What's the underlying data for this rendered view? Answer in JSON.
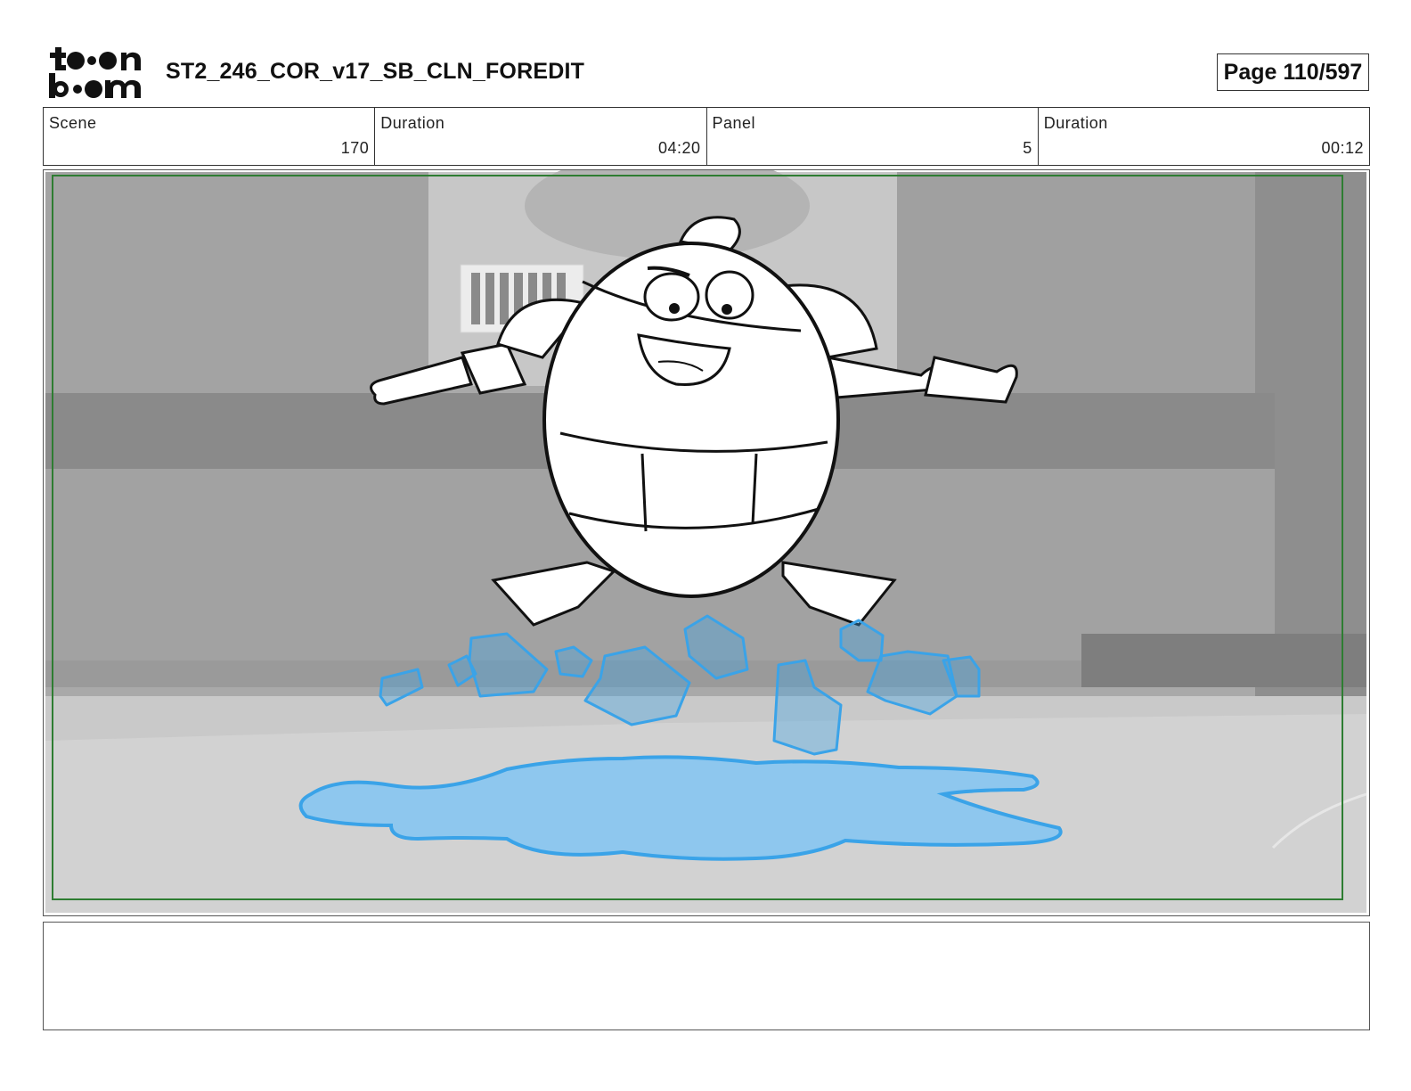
{
  "header": {
    "logo_alt": "toon boom",
    "title": "ST2_246_COR_v17_SB_CLN_FOREDIT",
    "page": "Page 110/597"
  },
  "info": [
    {
      "label": "Scene",
      "value": "170"
    },
    {
      "label": "Duration",
      "value": "04:20"
    },
    {
      "label": "Panel",
      "value": "5"
    },
    {
      "label": "Duration",
      "value": "00:12"
    }
  ],
  "panel": {
    "description": "",
    "safe_frame_color": "#2e7d32",
    "ice_color": "#3aa3e8"
  },
  "notes": {
    "text": ""
  }
}
